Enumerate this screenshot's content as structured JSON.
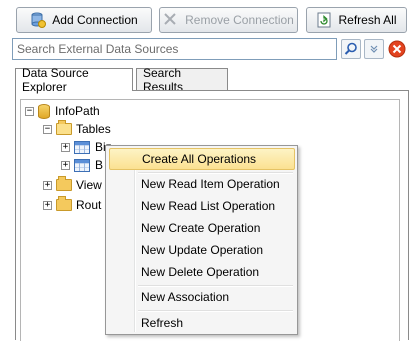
{
  "toolbar": {
    "add_label": "Add Connection",
    "remove_label": "Remove Connection",
    "refresh_label": "Refresh All"
  },
  "search": {
    "placeholder": "Search External Data Sources",
    "value": ""
  },
  "tabs": [
    {
      "label": "Data Source Explorer",
      "active": true
    },
    {
      "label": "Search Results",
      "active": false
    }
  ],
  "tree": {
    "root": "InfoPath",
    "tables": "Tables",
    "child1": "Biz",
    "child2": "B",
    "views": "View",
    "routines": "Rout"
  },
  "context_menu": {
    "items": [
      {
        "label": "Create All Operations",
        "highlighted": true
      },
      {
        "label": "New Read Item Operation"
      },
      {
        "label": "New Read List Operation"
      },
      {
        "label": "New Create Operation"
      },
      {
        "label": "New Update Operation"
      },
      {
        "label": "New Delete Operation"
      },
      {
        "label": "New Association"
      },
      {
        "label": "Refresh"
      }
    ]
  },
  "colors": {
    "highlight": "#fbe191",
    "clear_button": "#e3431f",
    "search_button": "#2a5db0"
  }
}
